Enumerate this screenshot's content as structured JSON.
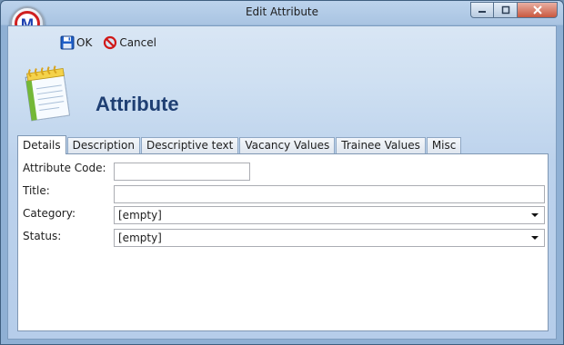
{
  "window": {
    "title": "Edit Attribute",
    "logo_letter": "M",
    "controls": {
      "minimize": "minimize-icon",
      "maximize": "maximize-icon",
      "close": "close-icon"
    }
  },
  "toolbar": {
    "ok_label": "OK",
    "ok_icon": "save-disk-icon",
    "cancel_label": "Cancel",
    "cancel_icon": "no-entry-icon"
  },
  "header": {
    "title": "Attribute",
    "icon": "notepad-icon"
  },
  "tabs": [
    {
      "label": "Details",
      "active": true
    },
    {
      "label": "Description",
      "active": false
    },
    {
      "label": "Descriptive text",
      "active": false
    },
    {
      "label": "Vacancy Values",
      "active": false
    },
    {
      "label": "Trainee Values",
      "active": false
    },
    {
      "label": "Misc",
      "active": false
    }
  ],
  "form": {
    "attribute_code": {
      "label": "Attribute Code:",
      "value": ""
    },
    "title": {
      "label": "Title:",
      "value": ""
    },
    "category": {
      "label": "Category:",
      "value": "[empty]"
    },
    "status": {
      "label": "Status:",
      "value": "[empty]"
    }
  },
  "colors": {
    "title_text": "#1f3f73",
    "cancel_red": "#d01818",
    "save_blue": "#1f5fc8"
  }
}
